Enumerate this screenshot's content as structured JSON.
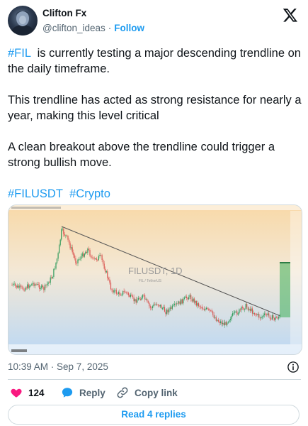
{
  "author": {
    "name": "Clifton Fx",
    "handle": "@clifton_ideas",
    "separator": "·",
    "follow_label": "Follow",
    "avatar_icon": "avatar-image"
  },
  "brand": {
    "icon": "x-logo-icon",
    "accent_color": "#1d9bf0",
    "like_color": "#f91880"
  },
  "tweet": {
    "p1_tag": "#FIL",
    "p1_text": "  is currently testing a major descending trendline on the daily timeframe.",
    "p2": "This trendline has acted as strong resistance for nearly a year, making this level critical",
    "p3": "A clean breakout above the trendline could trigger a strong bullish move.",
    "tags": [
      "#FILUSDT",
      "#Crypto"
    ]
  },
  "chart_image": {
    "symbol_label": "FILUSDT, 1D",
    "sub_label": "FIL / TetherUS"
  },
  "meta": {
    "timestamp": "10:39 AM · Sep 7, 2025"
  },
  "actions": {
    "like_count": "124",
    "reply_label": "Reply",
    "copy_label": "Copy link",
    "read_replies_label": "Read 4 replies"
  }
}
